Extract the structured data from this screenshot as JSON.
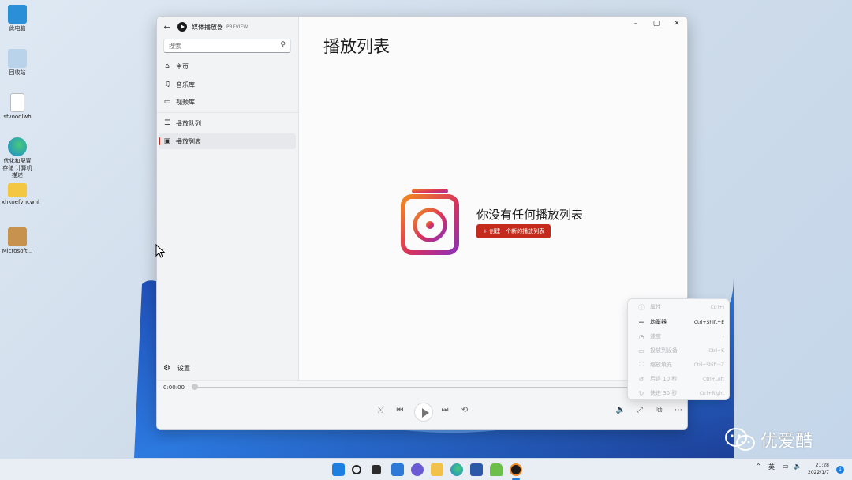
{
  "desktop": {
    "icons": [
      {
        "label": "此电脑",
        "icon": "computer-icon",
        "color": "#2a8fd6"
      },
      {
        "label": "回收站",
        "icon": "recycle-bin-icon",
        "color": "#6aa9d8"
      },
      {
        "label": "sfvoodlwh",
        "icon": "file-icon",
        "color": "#ffffff"
      },
      {
        "label": "优化和配置存储 计算机 描述",
        "icon": "edge-icon",
        "color": "#1e88d3"
      },
      {
        "label": "xhkoefvhcwhl",
        "icon": "folder-icon",
        "color": "#f3c742"
      },
      {
        "label": "Microsoft...",
        "icon": "package-icon",
        "color": "#c6924e"
      }
    ]
  },
  "app": {
    "name": "媒体播放器",
    "badge": "PREVIEW",
    "search_placeholder": "搜索",
    "nav": [
      {
        "label": "主页",
        "icon": "home-icon"
      },
      {
        "label": "音乐库",
        "icon": "music-icon"
      },
      {
        "label": "视频库",
        "icon": "video-icon"
      },
      {
        "label": "播放队列",
        "icon": "queue-icon"
      },
      {
        "label": "播放列表",
        "icon": "playlist-icon",
        "active": true
      }
    ],
    "settings_label": "设置",
    "page_title": "播放列表",
    "empty_message": "你没有任何播放列表",
    "create_button": "+ 创建一个新的播放列表",
    "time_elapsed": "0:00:00",
    "accent": "#c42b1c"
  },
  "context_menu": [
    {
      "label": "属性",
      "shortcut": "Ctrl+I",
      "icon": "info-icon",
      "enabled": false
    },
    {
      "label": "均衡器",
      "shortcut": "Ctrl+Shift+E",
      "icon": "equalizer-icon",
      "enabled": true
    },
    {
      "label": "速度",
      "shortcut": "›",
      "icon": "speed-icon",
      "enabled": false
    },
    {
      "label": "投放到设备",
      "shortcut": "Ctrl+K",
      "icon": "cast-icon",
      "enabled": false
    },
    {
      "label": "缩放填充",
      "shortcut": "Ctrl+Shift+Z",
      "icon": "zoom-fill-icon",
      "enabled": false
    },
    {
      "label": "后退 10 秒",
      "shortcut": "Ctrl+Left",
      "icon": "rewind-icon",
      "enabled": false
    },
    {
      "label": "快进 30 秒",
      "shortcut": "Ctrl+Right",
      "icon": "forward-icon",
      "enabled": false
    }
  ],
  "watermark": "优爱酷",
  "tray": {
    "ime": "英",
    "time": "21:28",
    "date": "2022/1/7",
    "notifications": "1"
  }
}
